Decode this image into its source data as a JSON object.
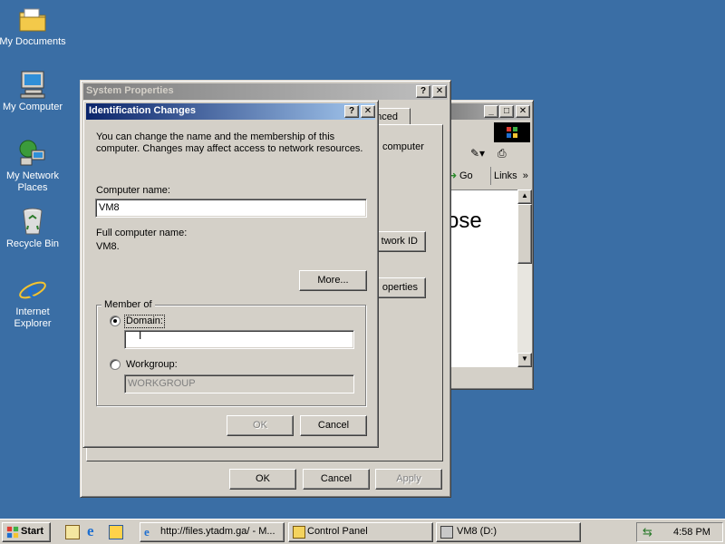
{
  "desktop": {
    "icons": [
      {
        "label": "My Documents"
      },
      {
        "label": "My Computer"
      },
      {
        "label": "My Network Places"
      },
      {
        "label": "Recycle Bin"
      },
      {
        "label": "Internet Explorer"
      }
    ]
  },
  "browser_window": {
    "fragment_text": "ose",
    "go_label": "Go",
    "links_label": "Links",
    "chevron": "»"
  },
  "system_properties": {
    "title": "System Properties",
    "help_glyph": "?",
    "close_glyph": "✕",
    "tab_label": "anced",
    "fragment_text": "computer",
    "network_id_label": "twork ID",
    "properties_label": "operties",
    "ok_label": "OK",
    "cancel_label": "Cancel",
    "apply_label": "Apply"
  },
  "identification_changes": {
    "title": "Identification Changes",
    "help_glyph": "?",
    "close_glyph": "✕",
    "description_line1": "You can change the name and the membership of this",
    "description_line2": "computer. Changes may affect access to network resources.",
    "computer_name_label": "Computer name:",
    "computer_name_value": "VM8",
    "full_name_label": "Full computer name:",
    "full_name_value": "VM8.",
    "more_label": "More...",
    "member_of_label": "Member of",
    "domain_label": "Domain:",
    "domain_value": "",
    "workgroup_label": "Workgroup:",
    "workgroup_value": "WORKGROUP",
    "ok_label": "OK",
    "cancel_label": "Cancel"
  },
  "taskbar": {
    "start_label": "Start",
    "tasks": [
      {
        "label": "http://files.ytadm.ga/ - M..."
      },
      {
        "label": "Control Panel"
      },
      {
        "label": "VM8 (D:)"
      }
    ],
    "clock": "4:58 PM"
  }
}
